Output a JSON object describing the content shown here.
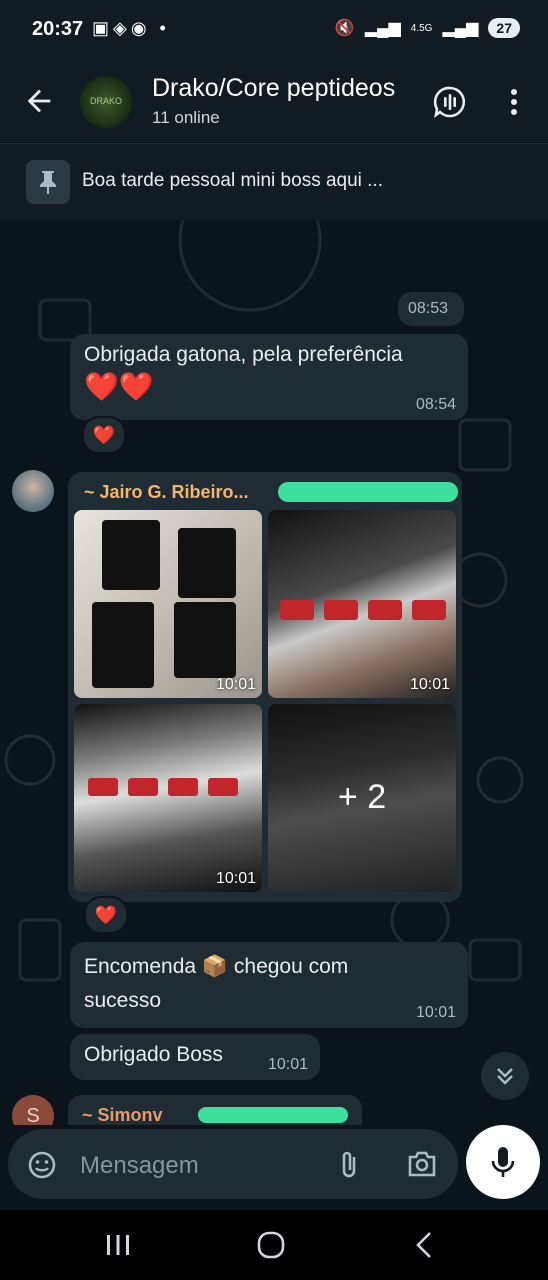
{
  "status_bar": {
    "time": "20:37",
    "battery": "27",
    "network": "4.5G"
  },
  "header": {
    "title": "Drako/Core peptideos",
    "subtitle": "11 online"
  },
  "pinned": {
    "text": "Boa tarde pessoal mini boss aqui ..."
  },
  "messages": [
    {
      "time": "08:53"
    },
    {
      "text_line1": "Obrigada gatona, pela preferência",
      "text_line2": "❤️❤️",
      "time": "08:54",
      "reaction": "❤️"
    },
    {
      "sender": "~ Jairo G. Ribeiro...",
      "photo_times": [
        "10:01",
        "10:01",
        "10:01"
      ],
      "more_count": "+ 2",
      "reaction": "❤️"
    },
    {
      "text_line1": "Encomenda 📦 chegou com",
      "text_line2": "sucesso",
      "time": "10:01"
    },
    {
      "text": "Obrigado Boss",
      "time": "10:01"
    },
    {
      "sender": "~ Simonv",
      "avatar_letter": "S"
    }
  ],
  "input": {
    "placeholder": "Mensagem"
  },
  "colors": {
    "sender1": "#f5b66e",
    "sender2": "#e89a6b",
    "mic_bg": "#ffffff",
    "bubble": "#202c33",
    "background": "#0b141a"
  }
}
